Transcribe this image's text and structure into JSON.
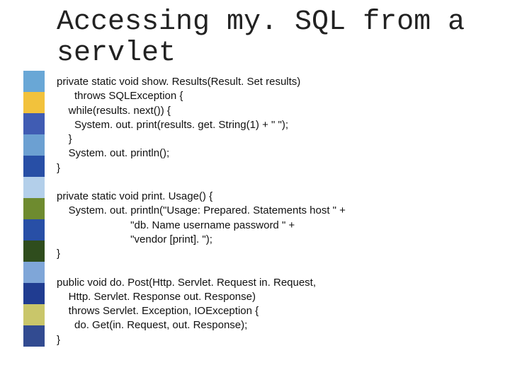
{
  "title": "Accessing my. SQL from a servlet",
  "sidebar_colors": [
    "#69a7d6",
    "#f2c23c",
    "#405cb3",
    "#6ca0d2",
    "#284fa6",
    "#b3cfea",
    "#6e8b2f",
    "#284fa6",
    "#2f4d1d",
    "#7fa6d8",
    "#203c91",
    "#c9c66a",
    "#324b91"
  ],
  "code": "private static void show. Results(Result. Set results)\n      throws SQLException {\n    while(results. next()) {\n      System. out. print(results. get. String(1) + \" \");\n    }\n    System. out. println();\n}\n\nprivate static void print. Usage() {\n    System. out. println(\"Usage: Prepared. Statements host \" +\n                         \"db. Name username password \" +\n                         \"vendor [print]. \");\n}\n\npublic void do. Post(Http. Servlet. Request in. Request,\n    Http. Servlet. Response out. Response)\n    throws Servlet. Exception, IOException {\n      do. Get(in. Request, out. Response);\n}"
}
